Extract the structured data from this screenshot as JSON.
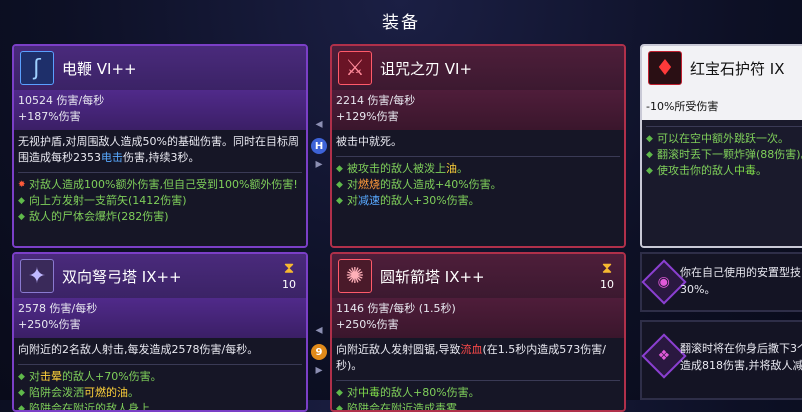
{
  "header": {
    "title": "装备"
  },
  "cards": [
    {
      "name": "电鞭 VI++",
      "stats": [
        "10524 伤害/每秒",
        "+187%伤害"
      ],
      "desc_lines": [
        [
          "无视护盾,对周围敌人造成50%的基础伤害。同时在目标周"
        ],
        [
          "围造成每秒2353",
          "电击",
          "伤害,持续3秒。"
        ]
      ],
      "mods": [
        "对敌人造成100%额外伤害,但自己受到100%额外伤害!",
        "向上方发射一支箭矢(1412伤害)",
        "敌人的尸体会爆炸(282伤害)"
      ]
    },
    {
      "name": "诅咒之刃 VI+",
      "stats": [
        "2214 伤害/每秒",
        "+129%伤害"
      ],
      "desc_lines": [
        [
          "被击中就死。"
        ]
      ],
      "mods": [
        "被攻击的敌人被泼上油。",
        "对燃烧的敌人造成+40%伤害。",
        "对减速的敌人+30%伤害。"
      ],
      "mod_highlight_words": [
        "油",
        "燃烧",
        "减速"
      ]
    },
    {
      "name": "红宝石护符 IX",
      "stats": [
        "-10%所受伤害"
      ],
      "mods": [
        "可以在空中额外跳跃一次。",
        "翻滚时丢下一颗炸弹(88伤害)。",
        "使攻击你的敌人中毒。"
      ],
      "mod_highlight_words": [
        "中毒"
      ]
    },
    {
      "name": "双向弩弓塔 IX++",
      "timer": "10",
      "stats": [
        "2578 伤害/每秒",
        "+250%伤害"
      ],
      "desc_lines": [
        [
          "向附近的2名敌人射击,每发造成2578伤害/每秒。"
        ]
      ],
      "mods": [
        "对击晕的敌人+70%伤害。",
        "陷阱会泼洒可燃的油。",
        "陷阱会在附近的敌人身上"
      ],
      "mod_highlight_words": [
        "击晕",
        "可燃的油"
      ]
    },
    {
      "name": "圆斩箭塔 IX++",
      "timer": "10",
      "stats": [
        "1146 伤害/每秒 (1.5秒)",
        "+250%伤害"
      ],
      "desc_lines": [
        [
          "向附近敌人发射圆锯,导致",
          "流血",
          "(在1.5秒内造成573伤害/"
        ],
        [
          "秒)。"
        ]
      ],
      "mods": [
        "对中毒的敌人+80%伤害。",
        "陷阱会在附近造成毒雾"
      ],
      "mod_highlight_words": [
        "中毒"
      ]
    }
  ],
  "connectors": [
    {
      "gem": "H",
      "gem_color": "#3d63d8"
    },
    {
      "gem": "9",
      "gem_color": "#e08a1a"
    }
  ],
  "passives": [
    {
      "lines": [
        "你在自己使用的安置型技",
        "30%。"
      ]
    },
    {
      "lines": [
        "翻滚时将在你身后撒下3个",
        "造成818伤害,并将敌人减"
      ]
    }
  ],
  "icons": {
    "whip": "lightning-whip-icon",
    "blade": "cursed-blade-icon",
    "amulet": "ruby-amulet-icon",
    "crossbow": "double-crossbow-turret-icon",
    "sawblade": "sawblade-turret-icon",
    "timer": "hourglass-icon"
  },
  "colors": {
    "purple_border": "#7b3fc7",
    "red_border": "#b0304a",
    "electric": "#58a9ff",
    "fire": "#ff9a3a",
    "bleed": "#ff4a4a",
    "poison": "#7fdb4a"
  }
}
